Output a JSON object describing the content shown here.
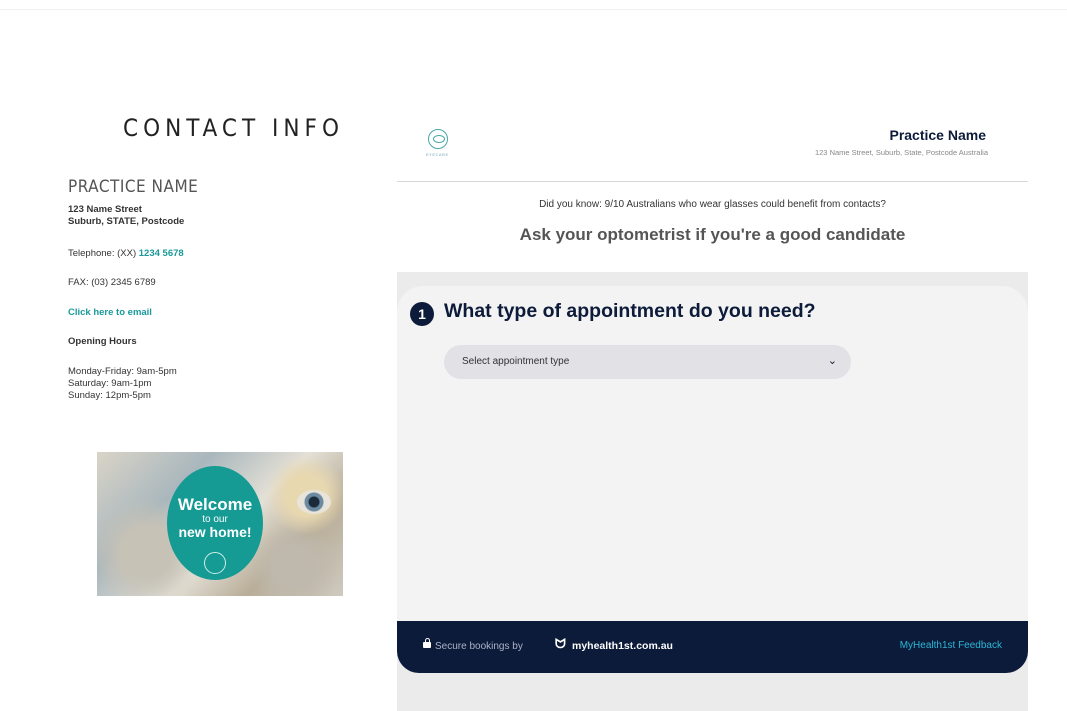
{
  "contact": {
    "title": "CONTACT INFO",
    "practice_name": "PRACTICE NAME",
    "address_line1": "123 Name Street",
    "address_line2": "Suburb, STATE, Postcode",
    "telephone_label": "Telephone: (XX) ",
    "telephone_number": "1234 5678",
    "fax": "FAX: (03) 2345 6789",
    "email_link": "Click here to email",
    "hours_title": "Opening Hours",
    "hours": [
      "Monday-Friday: 9am-5pm",
      "Saturday: 9am-1pm",
      "Sunday: 12pm-5pm"
    ]
  },
  "promo": {
    "line1": "Welcome",
    "line2": "to our",
    "line3": "new home!",
    "accent": "#159a94"
  },
  "panel": {
    "practice_name": "Practice Name",
    "practice_address": "123 Name Street, Suburb, State, Postcode Australia",
    "logo_text": "EYECARE",
    "info_line": "Did you know: 9/10 Australians who wear glasses could benefit from contacts?",
    "info_cta": "Ask your optometrist if you're a good candidate",
    "step_number": "1",
    "step_title": "What type of appointment do you need?",
    "select_placeholder": "Select appointment type",
    "footer": {
      "secure_text": "Secure bookings by",
      "brand": "myhealth1st.com.au",
      "feedback": "MyHealth1st Feedback"
    }
  },
  "colors": {
    "navy": "#0d1b3a",
    "teal": "#1a9a9a",
    "link_blue": "#2bb6d6"
  }
}
